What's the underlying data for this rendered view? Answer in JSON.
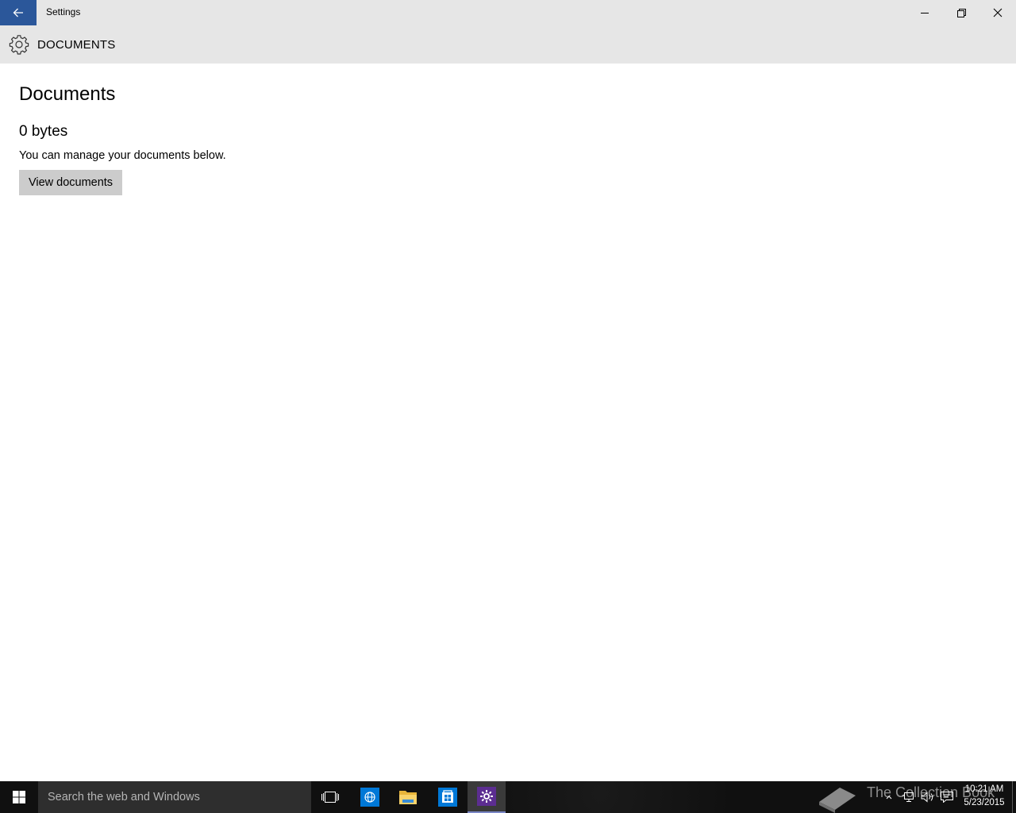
{
  "window": {
    "title": "Settings"
  },
  "header": {
    "title": "DOCUMENTS"
  },
  "main": {
    "page_title": "Documents",
    "size_value": "0 bytes",
    "description": "You can manage your documents below.",
    "view_button_label": "View documents"
  },
  "taskbar": {
    "search_placeholder": "Search the web and Windows",
    "pinned": [
      "task-view-icon",
      "internet-explorer-icon",
      "file-explorer-icon",
      "store-icon",
      "settings-icon"
    ],
    "active_app": "settings",
    "watermark_text": "The Collection Book",
    "clock": {
      "time": "10:21 AM",
      "date": "5/23/2015"
    }
  },
  "colors": {
    "accent": "#2b579a",
    "titlebar_bg": "#e6e6e6",
    "button_bg": "#cccccc",
    "taskbar_bg": "#101010",
    "search_bg": "#2e2e2e",
    "settings_icon_bg": "#5c2d91"
  }
}
